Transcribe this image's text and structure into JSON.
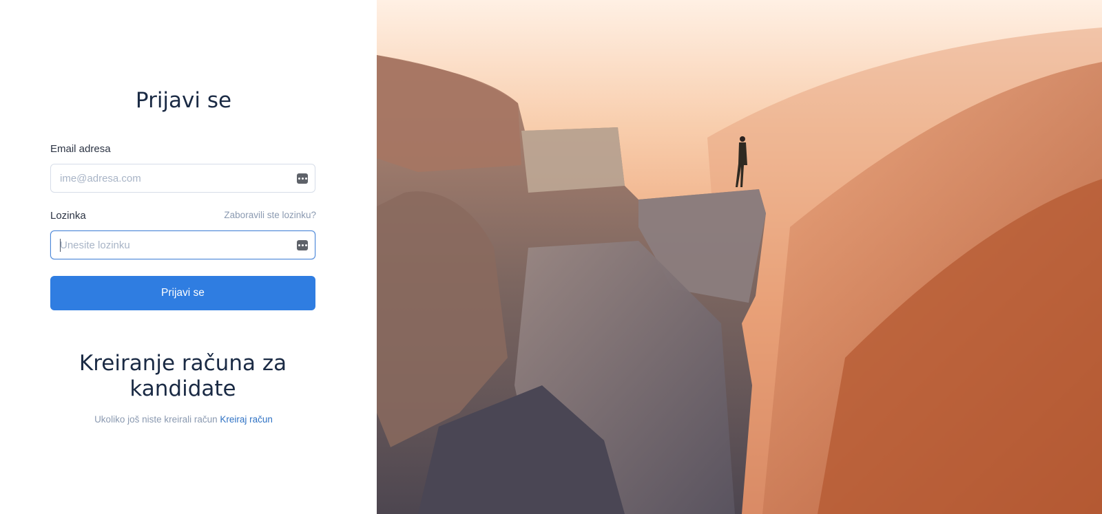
{
  "login": {
    "title": "Prijavi se",
    "email_label": "Email adresa",
    "email_placeholder": "ime@adresa.com",
    "password_label": "Lozinka",
    "forgot_link": "Zaboravili ste lozinku?",
    "password_placeholder": "Unesite lozinku",
    "submit_label": "Prijavi se"
  },
  "signup": {
    "title": "Kreiranje računa za kandidate",
    "helper_text": "Ukoliko još niste kreirali račun",
    "link_text": "Kreiraj račun"
  },
  "icons": {
    "field_icon": "password-manager-key-icon"
  },
  "colors": {
    "accent": "#2f7de1",
    "heading": "#1a2a44",
    "muted": "#8a99b0",
    "link": "#2f72c4"
  }
}
